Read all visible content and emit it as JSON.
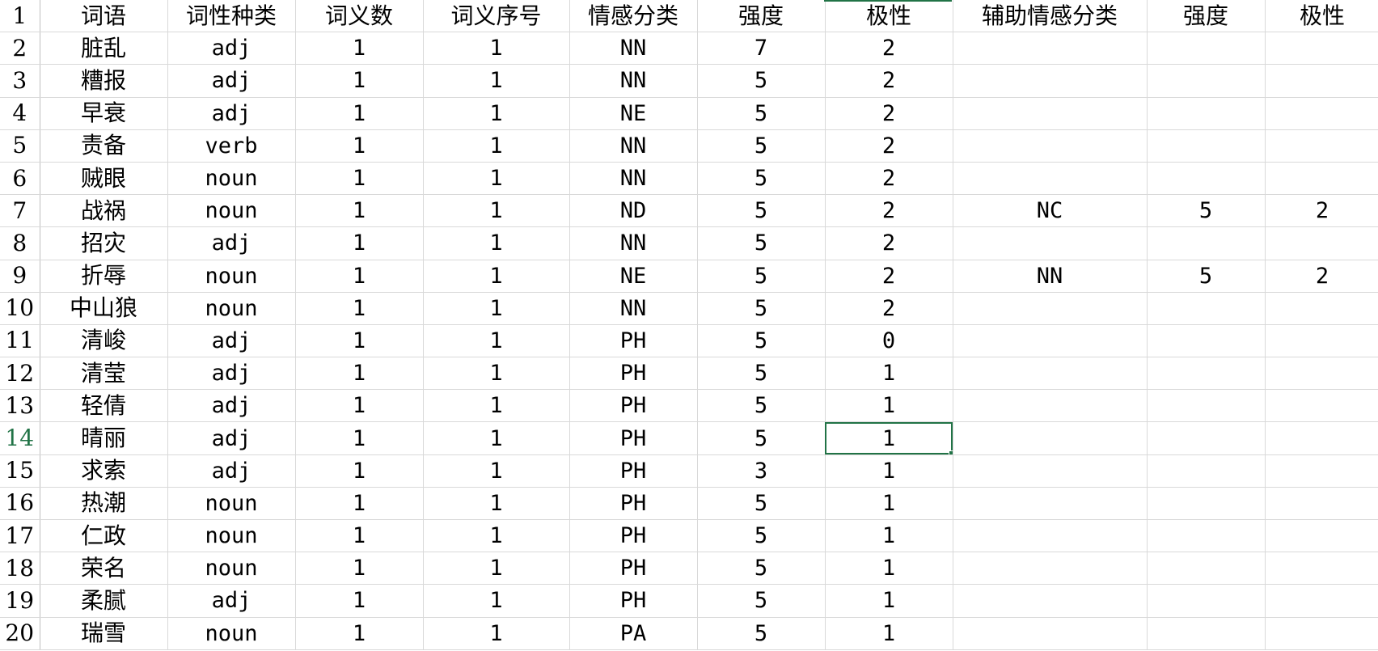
{
  "sheet": {
    "columns": 12,
    "active_cell": {
      "row": 14,
      "col": 7
    },
    "accent_color": "#217346",
    "rows": [
      {
        "num": "1",
        "cells": [
          "词语",
          "词性种类",
          "词义数",
          "词义序号",
          "情感分类",
          "强度",
          "极性",
          "辅助情感分类",
          "强度",
          "极性",
          ""
        ]
      },
      {
        "num": "2",
        "cells": [
          "脏乱",
          "adj",
          "1",
          "1",
          "NN",
          "7",
          "2",
          "",
          "",
          "",
          ""
        ]
      },
      {
        "num": "3",
        "cells": [
          "糟报",
          "adj",
          "1",
          "1",
          "NN",
          "5",
          "2",
          "",
          "",
          "",
          ""
        ]
      },
      {
        "num": "4",
        "cells": [
          "早衰",
          "adj",
          "1",
          "1",
          "NE",
          "5",
          "2",
          "",
          "",
          "",
          ""
        ]
      },
      {
        "num": "5",
        "cells": [
          "责备",
          "verb",
          "1",
          "1",
          "NN",
          "5",
          "2",
          "",
          "",
          "",
          ""
        ]
      },
      {
        "num": "6",
        "cells": [
          "贼眼",
          "noun",
          "1",
          "1",
          "NN",
          "5",
          "2",
          "",
          "",
          "",
          ""
        ]
      },
      {
        "num": "7",
        "cells": [
          "战祸",
          "noun",
          "1",
          "1",
          "ND",
          "5",
          "2",
          "NC",
          "5",
          "2",
          ""
        ]
      },
      {
        "num": "8",
        "cells": [
          "招灾",
          "adj",
          "1",
          "1",
          "NN",
          "5",
          "2",
          "",
          "",
          "",
          ""
        ]
      },
      {
        "num": "9",
        "cells": [
          "折辱",
          "noun",
          "1",
          "1",
          "NE",
          "5",
          "2",
          "NN",
          "5",
          "2",
          ""
        ]
      },
      {
        "num": "10",
        "cells": [
          "中山狼",
          "noun",
          "1",
          "1",
          "NN",
          "5",
          "2",
          "",
          "",
          "",
          ""
        ]
      },
      {
        "num": "11",
        "cells": [
          "清峻",
          "adj",
          "1",
          "1",
          "PH",
          "5",
          "0",
          "",
          "",
          "",
          ""
        ]
      },
      {
        "num": "12",
        "cells": [
          "清莹",
          "adj",
          "1",
          "1",
          "PH",
          "5",
          "1",
          "",
          "",
          "",
          ""
        ]
      },
      {
        "num": "13",
        "cells": [
          "轻倩",
          "adj",
          "1",
          "1",
          "PH",
          "5",
          "1",
          "",
          "",
          "",
          ""
        ]
      },
      {
        "num": "14",
        "cells": [
          "晴丽",
          "adj",
          "1",
          "1",
          "PH",
          "5",
          "1",
          "",
          "",
          "",
          ""
        ]
      },
      {
        "num": "15",
        "cells": [
          "求索",
          "adj",
          "1",
          "1",
          "PH",
          "3",
          "1",
          "",
          "",
          "",
          ""
        ]
      },
      {
        "num": "16",
        "cells": [
          "热潮",
          "noun",
          "1",
          "1",
          "PH",
          "5",
          "1",
          "",
          "",
          "",
          ""
        ]
      },
      {
        "num": "17",
        "cells": [
          "仁政",
          "noun",
          "1",
          "1",
          "PH",
          "5",
          "1",
          "",
          "",
          "",
          ""
        ]
      },
      {
        "num": "18",
        "cells": [
          "荣名",
          "noun",
          "1",
          "1",
          "PH",
          "5",
          "1",
          "",
          "",
          "",
          ""
        ]
      },
      {
        "num": "19",
        "cells": [
          "柔腻",
          "adj",
          "1",
          "1",
          "PH",
          "5",
          "1",
          "",
          "",
          "",
          ""
        ]
      },
      {
        "num": "20",
        "cells": [
          "瑞雪",
          "noun",
          "1",
          "1",
          "PA",
          "5",
          "1",
          "",
          "",
          "",
          ""
        ]
      }
    ]
  }
}
